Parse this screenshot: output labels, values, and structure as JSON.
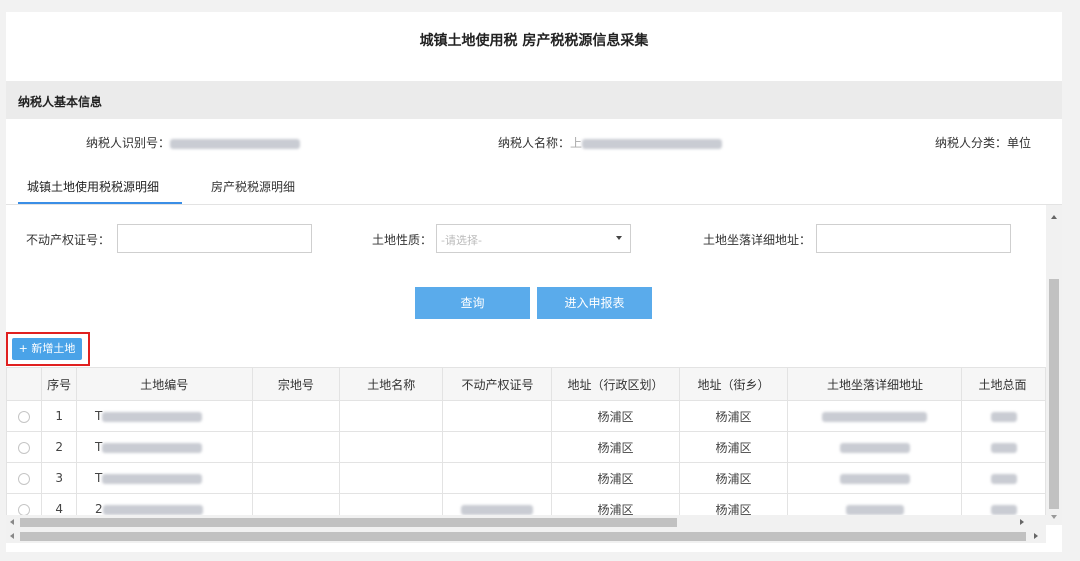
{
  "page": {
    "title": "城镇土地使用税 房产税税源信息采集"
  },
  "basic_info": {
    "section_title": "纳税人基本信息",
    "taxpayer_id_label": "纳税人识别号：",
    "taxpayer_name_label": "纳税人名称：",
    "taxpayer_name_prefix": "上",
    "taxpayer_category_label": "纳税人分类：",
    "taxpayer_category_value": "单位"
  },
  "tabs": [
    {
      "label": "城镇土地使用税税源明细",
      "active": true
    },
    {
      "label": "房产税税源明细",
      "active": false
    }
  ],
  "search": {
    "property_cert_label": "不动产权证号：",
    "property_cert_value": "",
    "land_nature_label": "土地性质：",
    "land_nature_placeholder": "-请选择-",
    "address_label": "土地坐落详细地址：",
    "address_value": "",
    "query_button": "查询",
    "declare_button": "进入申报表"
  },
  "add_button": "+ 新增土地",
  "table": {
    "columns": [
      "",
      "序号",
      "土地编号",
      "宗地号",
      "土地名称",
      "不动产权证号",
      "地址（行政区划）",
      "地址（街乡）",
      "土地坐落详细地址",
      "土地总面"
    ],
    "rows": [
      {
        "index": "1",
        "land_no_prefix": "T",
        "district": "杨浦区",
        "street": "杨浦区"
      },
      {
        "index": "2",
        "land_no_prefix": "T",
        "district": "杨浦区",
        "street": "杨浦区"
      },
      {
        "index": "3",
        "land_no_prefix": "T",
        "district": "杨浦区",
        "street": "杨浦区"
      },
      {
        "index": "4",
        "land_no_prefix": "2",
        "district": "杨浦区",
        "street": "杨浦区"
      }
    ]
  },
  "colors": {
    "primary_button": "#5aabeb",
    "highlight_border": "#e02020",
    "tab_underline": "#3a8ee6"
  }
}
